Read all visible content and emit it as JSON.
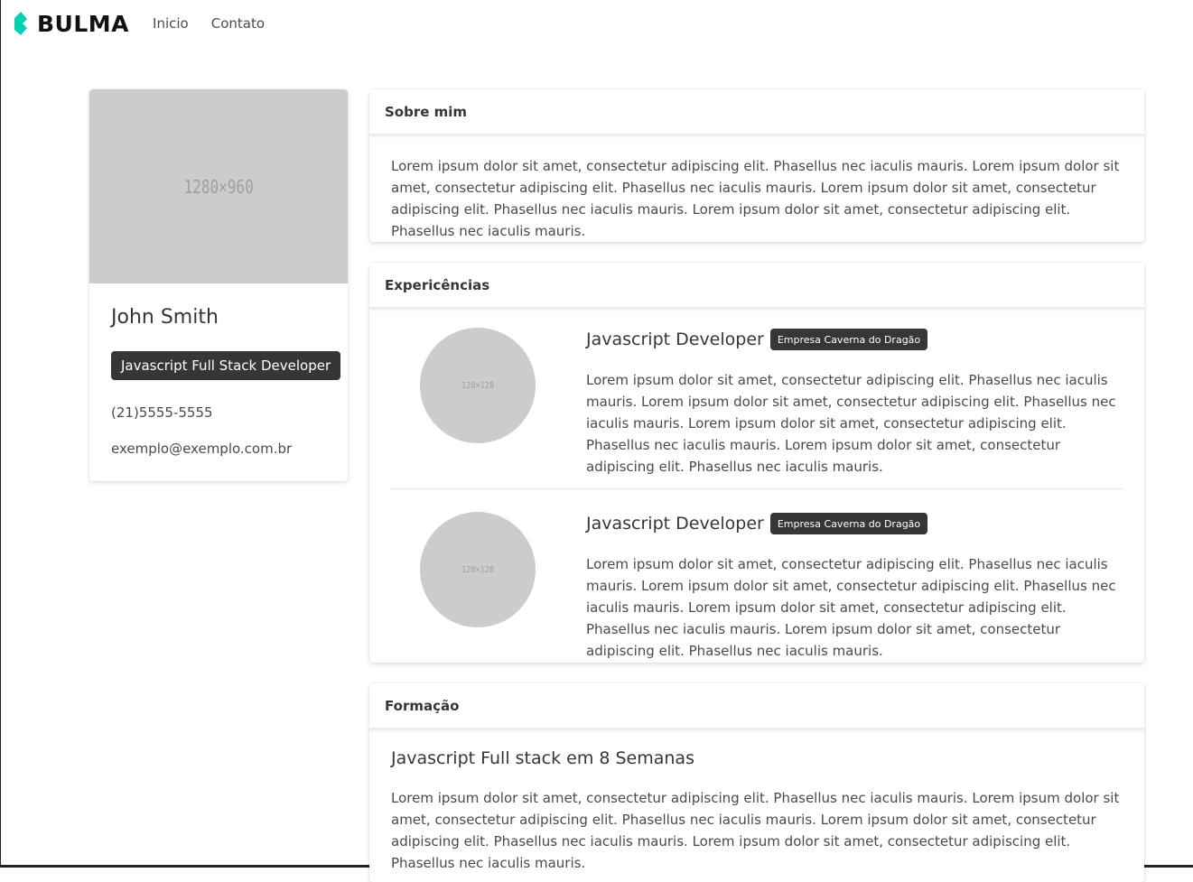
{
  "navbar": {
    "brand": "BULMA",
    "brand_color": "#00d1b2",
    "links": [
      "Inicio",
      "Contato"
    ]
  },
  "profile": {
    "image_placeholder": "1280×960",
    "name": "John Smith",
    "role": "Javascript Full Stack Developer",
    "phone": "(21)5555-5555",
    "email": "exemplo@exemplo.com.br"
  },
  "about": {
    "title": "Sobre mim",
    "text": "Lorem ipsum dolor sit amet, consectetur adipiscing elit. Phasellus nec iaculis mauris. Lorem ipsum dolor sit amet, consectetur adipiscing elit. Phasellus nec iaculis mauris. Lorem ipsum dolor sit amet, consectetur adipiscing elit. Phasellus nec iaculis mauris. Lorem ipsum dolor sit amet, consectetur adipiscing elit. Phasellus nec iaculis mauris."
  },
  "experience": {
    "title": "Expericências",
    "items": [
      {
        "avatar_placeholder": "128×128",
        "title": "Javascript Developer",
        "company": "Empresa Caverna do Dragão",
        "description": "Lorem ipsum dolor sit amet, consectetur adipiscing elit. Phasellus nec iaculis mauris. Lorem ipsum dolor sit amet, consectetur adipiscing elit. Phasellus nec iaculis mauris. Lorem ipsum dolor sit amet, consectetur adipiscing elit. Phasellus nec iaculis mauris. Lorem ipsum dolor sit amet, consectetur adipiscing elit. Phasellus nec iaculis mauris."
      },
      {
        "avatar_placeholder": "128×128",
        "title": "Javascript Developer",
        "company": "Empresa Caverna do Dragão",
        "description": "Lorem ipsum dolor sit amet, consectetur adipiscing elit. Phasellus nec iaculis mauris. Lorem ipsum dolor sit amet, consectetur adipiscing elit. Phasellus nec iaculis mauris. Lorem ipsum dolor sit amet, consectetur adipiscing elit. Phasellus nec iaculis mauris. Lorem ipsum dolor sit amet, consectetur adipiscing elit. Phasellus nec iaculis mauris."
      }
    ]
  },
  "education": {
    "title": "Formação",
    "course": "Javascript Full stack em 8 Semanas",
    "text": "Lorem ipsum dolor sit amet, consectetur adipiscing elit. Phasellus nec iaculis mauris. Lorem ipsum dolor sit amet, consectetur adipiscing elit. Phasellus nec iaculis mauris. Lorem ipsum dolor sit amet, consectetur adipiscing elit. Phasellus nec iaculis mauris. Lorem ipsum dolor sit amet, consectetur adipiscing elit. Phasellus nec iaculis mauris."
  }
}
